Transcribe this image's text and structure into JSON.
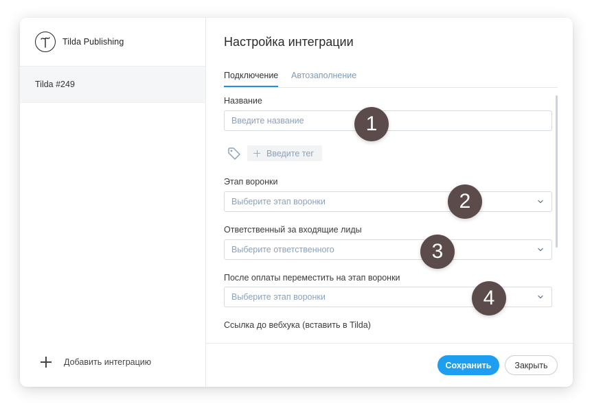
{
  "brand": {
    "name": "Tilda Publishing",
    "logo_letter": "T"
  },
  "sidebar": {
    "items": [
      {
        "label": "Tilda #249"
      }
    ],
    "add_integration_label": "Добавить интеграцию"
  },
  "main": {
    "title": "Настройка интеграции",
    "tabs": [
      {
        "label": "Подключение",
        "active": true
      },
      {
        "label": "Автозаполнение",
        "active": false
      }
    ],
    "fields": {
      "name": {
        "label": "Название",
        "placeholder": "Введите название",
        "value": ""
      },
      "tag": {
        "placeholder": "Введите тег"
      },
      "funnel_stage": {
        "label": "Этап воронки",
        "placeholder": "Выберите этап воронки"
      },
      "responsible": {
        "label": "Ответственный за входящие лиды",
        "placeholder": "Выберите ответственного"
      },
      "after_payment_stage": {
        "label": "После оплаты переместить на этап воронки",
        "placeholder": "Выберите этап воронки"
      },
      "webhook": {
        "label": "Ссылка до вебхука (вставить в Tilda)"
      }
    },
    "footer": {
      "save_label": "Сохранить",
      "close_label": "Закрыть"
    }
  },
  "callouts": [
    "1",
    "2",
    "3",
    "4"
  ],
  "colors": {
    "accent": "#1e9ef0",
    "tab_underline": "#1e8fe1",
    "callout_bg": "#5c4b4b",
    "placeholder": "#8aa2bb"
  }
}
